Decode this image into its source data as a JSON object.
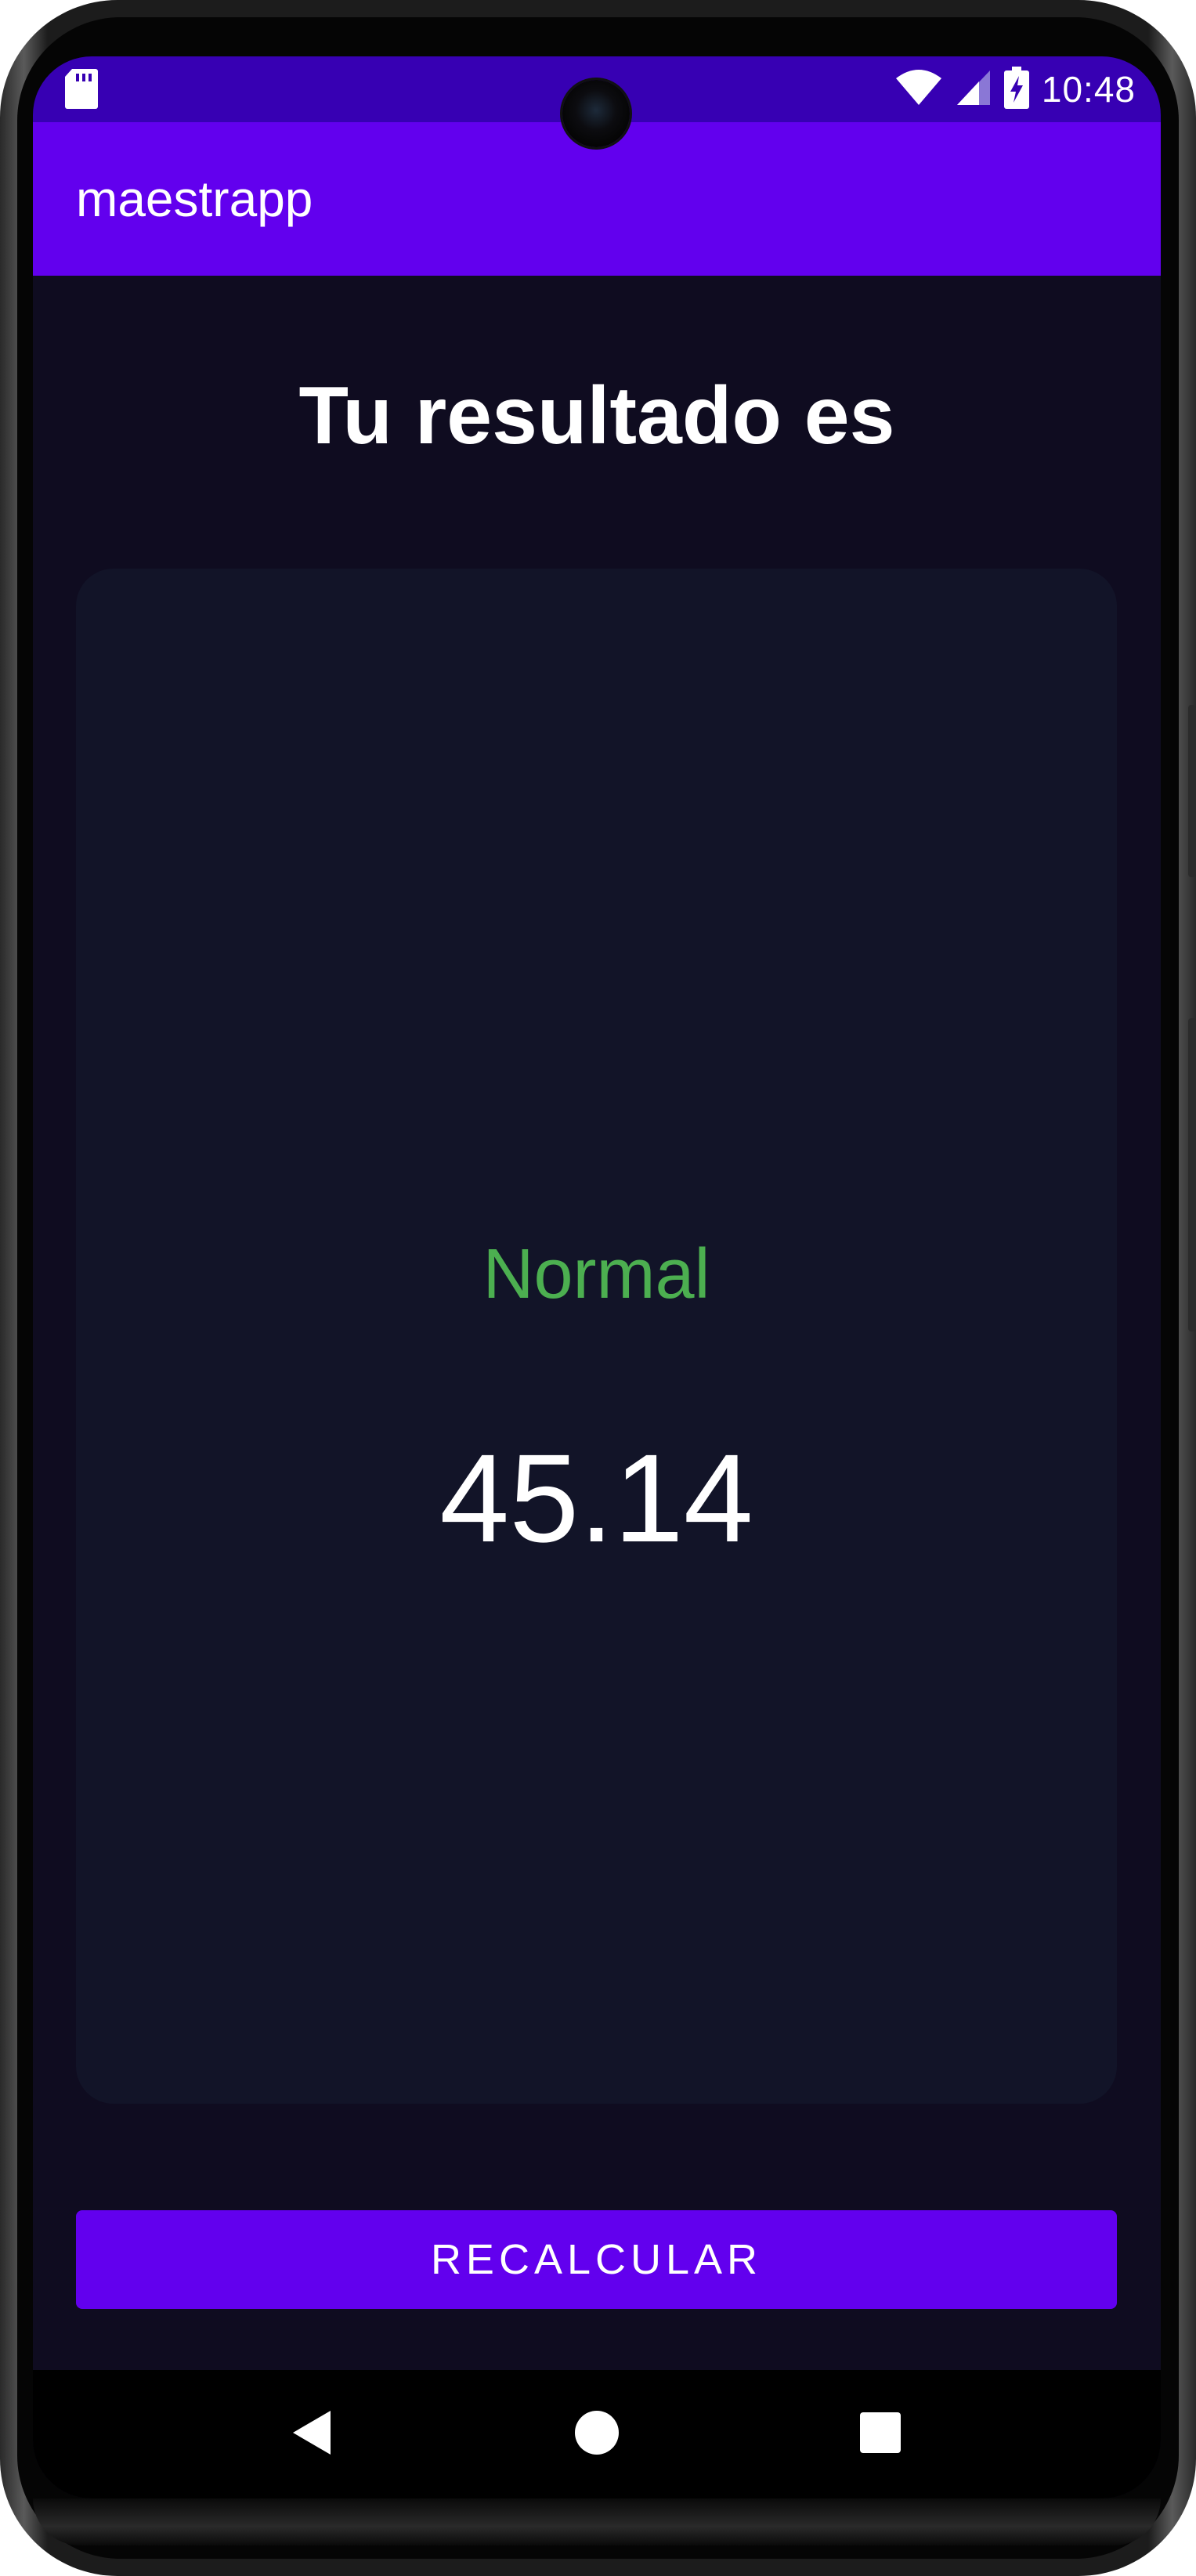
{
  "status_bar": {
    "time": "10:48",
    "icons": [
      "sd-card-icon",
      "wifi-icon",
      "cell-signal-icon",
      "battery-charging-icon"
    ]
  },
  "app_bar": {
    "title": "maestrapp"
  },
  "result": {
    "heading": "Tu resultado es",
    "status_label": "Normal",
    "value": "45.14"
  },
  "actions": {
    "recalculate_label": "RECALCULAR"
  },
  "navigation": {
    "icons": [
      "back-icon",
      "home-icon",
      "recents-icon"
    ]
  },
  "colors": {
    "status_bar": "#3700b3",
    "primary": "#6200ee",
    "background": "#0f0c20",
    "card": "#121428",
    "status_normal": "#4caf50",
    "text": "#ffffff"
  }
}
